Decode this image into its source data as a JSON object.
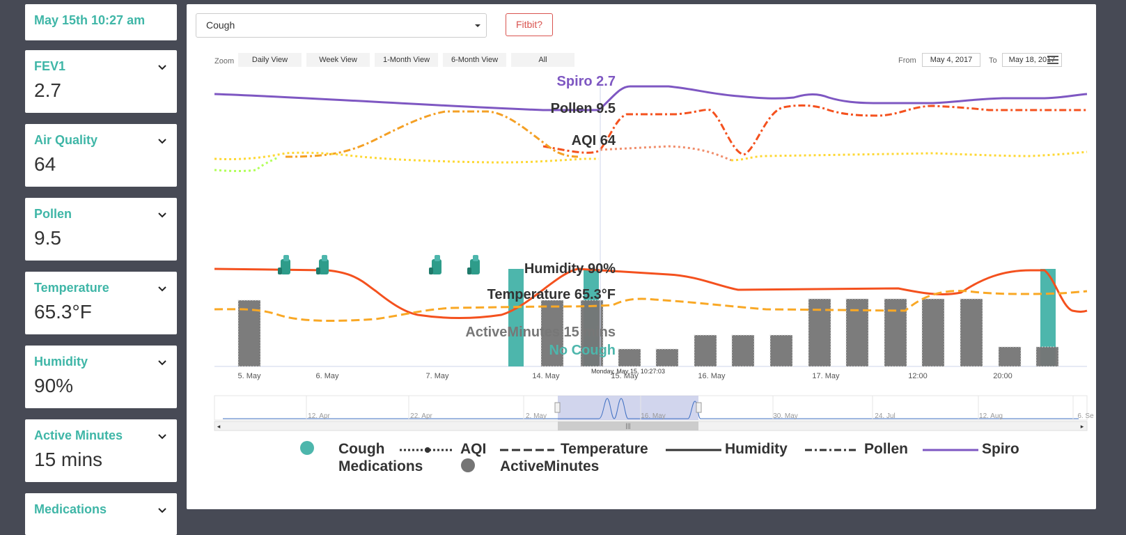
{
  "sidebar": {
    "datetime": "May 15th 10:27 am",
    "cards": [
      {
        "label": "FEV1",
        "value": "2.7"
      },
      {
        "label": "Air Quality",
        "value": "64"
      },
      {
        "label": "Pollen",
        "value": "9.5"
      },
      {
        "label": "Temperature",
        "value": "65.3°F"
      },
      {
        "label": "Humidity",
        "value": "90%"
      },
      {
        "label": "Active Minutes",
        "value": "15 mins"
      },
      {
        "label": "Medications",
        "value": ""
      }
    ]
  },
  "toolbar": {
    "symptom_select": "Cough",
    "fitbit_label": "Fitbit?"
  },
  "zoom": {
    "label": "Zoom",
    "buttons": [
      "Daily View",
      "Week View",
      "1-Month View",
      "6-Month View",
      "All"
    ]
  },
  "range": {
    "from_label": "From",
    "from_value": "May 4, 2017",
    "to_label": "To",
    "to_value": "May 18, 2017"
  },
  "tooltip": {
    "timestamp": "Monday, May 15, 10:27:03",
    "spiro": "Spiro 2.7",
    "pollen": "Pollen 9.5",
    "aqi": "AQI 64",
    "humidity": "Humidity 90%",
    "temperature": "Temperature 65.3°F",
    "active_minutes": "ActiveMinutes 15 mins",
    "cough": "No Cough"
  },
  "chart_data": {
    "type": "line",
    "x_tick_labels": [
      "5. May",
      "6. May",
      "7. May",
      "14. May",
      "15. May",
      "16. May",
      "17. May",
      "12:00",
      "20:00"
    ],
    "active_minutes_bars": [
      {
        "x": "5. May",
        "value": 95
      },
      {
        "x": "14. May",
        "value": 95
      },
      {
        "x": "15. May",
        "value": 95
      },
      {
        "x": "15. May",
        "value": 25
      },
      {
        "x": "15. May",
        "value": 25
      },
      {
        "x": "16. May",
        "value": 45
      },
      {
        "x": "16. May",
        "value": 45
      },
      {
        "x": "16. May",
        "value": 45
      },
      {
        "x": "17. May",
        "value": 97
      },
      {
        "x": "17. May",
        "value": 97
      },
      {
        "x": "12:00",
        "value": 97
      },
      {
        "x": "12:00",
        "value": 97
      },
      {
        "x": "12:00",
        "value": 97
      },
      {
        "x": "20:00",
        "value": 28
      },
      {
        "x": "20:00",
        "value": 28
      }
    ],
    "cough_bars": [
      {
        "x": "7. May",
        "value": 140
      },
      {
        "x": "15. May",
        "value": 140
      },
      {
        "x": "20:00",
        "value": 140
      }
    ],
    "medication_markers": [
      "5. May",
      "6. May",
      "7. May",
      "7. May"
    ],
    "navigator_tick_labels": [
      "12. Apr",
      "22. Apr",
      "2. May",
      "16. May",
      "30. May",
      "24. Jul",
      "12. Aug",
      "6. Se"
    ],
    "legend": [
      "Cough",
      "AQI",
      "Temperature",
      "Humidity",
      "Pollen",
      "Spiro",
      "Medications",
      "ActiveMinutes"
    ],
    "colors": {
      "spiro": "#7e57c2",
      "pollen": "#f4511e",
      "aqi": "#fdd835",
      "humidity": "#f4511e",
      "temperature": "#f9a825",
      "cough": "#4db6ac",
      "active_minutes": "#757575",
      "navigator": "#c5cae9",
      "accent": "#3fb6a7"
    }
  }
}
